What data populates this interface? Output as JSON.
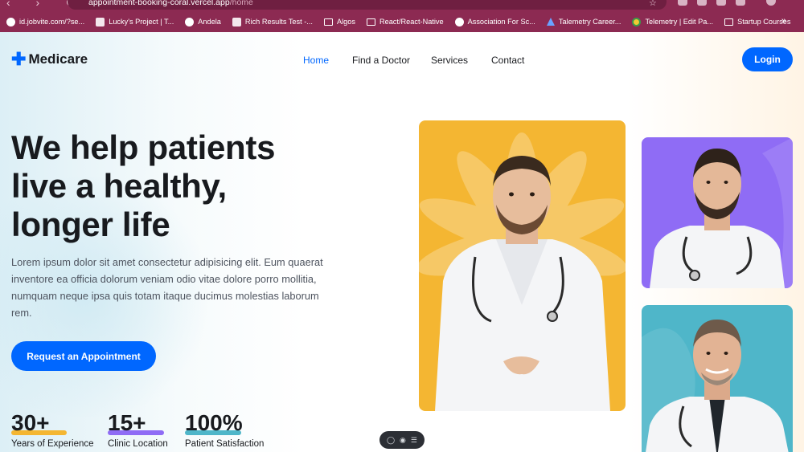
{
  "browser": {
    "url_host": "appointment-booking-coral.vercel.app",
    "url_path": "/home",
    "bookmarks": [
      {
        "label": "id.jobvite.com/?se...",
        "icon": "globe-icon"
      },
      {
        "label": "Lucky's Project | T...",
        "icon": "page-icon"
      },
      {
        "label": "Andela",
        "icon": "andela-icon"
      },
      {
        "label": "Rich Results Test -...",
        "icon": "rich-results-icon"
      },
      {
        "label": "Algos",
        "icon": "folder-icon"
      },
      {
        "label": "React/React-Native",
        "icon": "folder-icon"
      },
      {
        "label": "Association For Sc...",
        "icon": "globe-icon"
      },
      {
        "label": "Talemetry Career...",
        "icon": "talemetry-icon"
      },
      {
        "label": "Telemetry | Edit Pa...",
        "icon": "circle-icon"
      },
      {
        "label": "Startup Courses",
        "icon": "folder-icon"
      }
    ],
    "more": "»"
  },
  "header": {
    "logo_symbol": "✚",
    "logo_text": "Medicare",
    "nav": [
      "Home",
      "Find a Doctor",
      "Services",
      "Contact"
    ],
    "active_nav": "Home",
    "login_label": "Login"
  },
  "hero": {
    "headline_lines": [
      "We help patients",
      "live a healthy,",
      "longer life"
    ],
    "description": "Lorem ipsum dolor sit amet consectetur adipisicing elit. Eum quaerat inventore ea officia dolorum veniam odio vitae dolore porro mollitia, numquam neque ipsa quis totam itaque ducimus molestias laborum rem.",
    "cta_label": "Request an Appointment"
  },
  "stats": [
    {
      "value": "30+",
      "label": "Years of Experience",
      "color": "#f4b632"
    },
    {
      "value": "15+",
      "label": "Clinic Location",
      "color": "#8f6cf5"
    },
    {
      "value": "100%",
      "label": "Patient Satisfaction",
      "color": "#4fb6c9"
    }
  ],
  "images": {
    "main_doctor": {
      "background": "#f4b632"
    },
    "doctor_two": {
      "background": "#8f6cf5"
    },
    "doctor_three": {
      "background": "#4fb6c9"
    }
  },
  "accent_color": "#0067ff"
}
